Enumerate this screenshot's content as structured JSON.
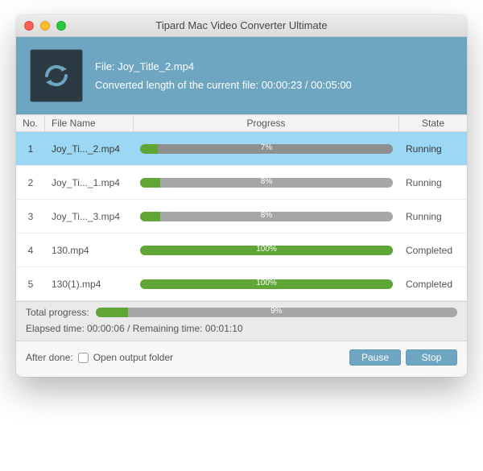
{
  "window": {
    "title": "Tipard Mac Video Converter Ultimate"
  },
  "info": {
    "file_label": "File:",
    "file_name": "Joy_Title_2.mp4",
    "length_label": "Converted length of the current file:",
    "elapsed": "00:00:23",
    "sep": "/",
    "duration": "00:05:00",
    "icon": "convert-cycle-icon"
  },
  "columns": {
    "no": "No.",
    "name": "File Name",
    "progress": "Progress",
    "state": "State"
  },
  "rows": [
    {
      "no": "1",
      "name": "Joy_Ti..._2.mp4",
      "percent": 7,
      "label": "7%",
      "state": "Running",
      "selected": true
    },
    {
      "no": "2",
      "name": "Joy_Ti..._1.mp4",
      "percent": 8,
      "label": "8%",
      "state": "Running",
      "selected": false
    },
    {
      "no": "3",
      "name": "Joy_Ti..._3.mp4",
      "percent": 8,
      "label": "8%",
      "state": "Running",
      "selected": false
    },
    {
      "no": "4",
      "name": "130.mp4",
      "percent": 100,
      "label": "100%",
      "state": "Completed",
      "selected": false
    },
    {
      "no": "5",
      "name": "130(1).mp4",
      "percent": 100,
      "label": "100%",
      "state": "Completed",
      "selected": false
    }
  ],
  "total": {
    "label": "Total progress:",
    "percent": 9,
    "text": "9%"
  },
  "timing": {
    "elapsed_label": "Elapsed time:",
    "elapsed": "00:00:06",
    "sep": "/",
    "remaining_label": "Remaining time:",
    "remaining": "00:01:10"
  },
  "footer": {
    "after_done_label": "After done:",
    "checkbox_label": "Open output folder",
    "pause": "Pause",
    "stop": "Stop"
  },
  "colors": {
    "accent": "#6ea6c1",
    "progress_fill": "#5fa636",
    "row_selected": "#9cd7f4"
  }
}
